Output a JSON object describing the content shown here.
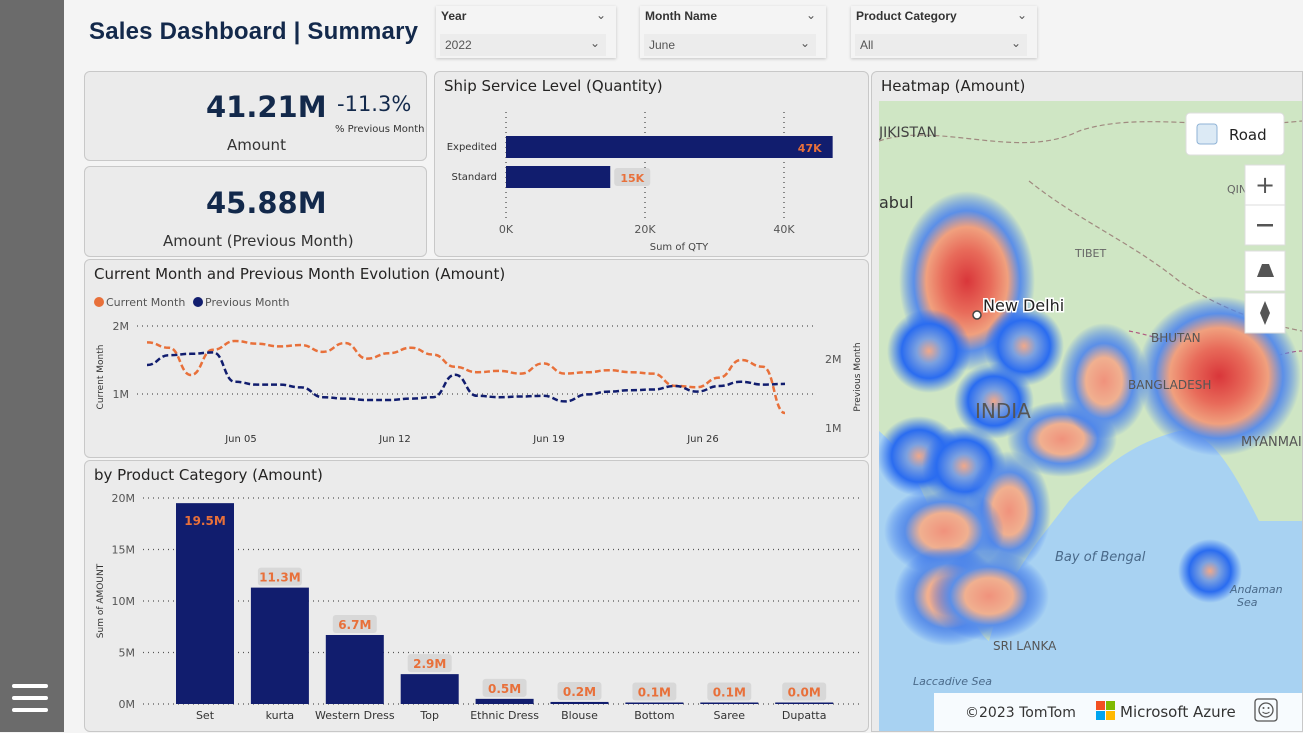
{
  "header": {
    "title": "Sales Dashboard | Summary"
  },
  "slicers": [
    {
      "label": "Year",
      "value": "2022"
    },
    {
      "label": "Month Name",
      "value": "June"
    },
    {
      "label": "Product Category",
      "value": "All"
    }
  ],
  "kpi_amount": {
    "value": "41.21M",
    "label": "Amount",
    "change": "-11.3%",
    "change_label": "% Previous Month"
  },
  "kpi_prev": {
    "value": "45.88M",
    "label": "Amount (Previous Month)"
  },
  "ship": {
    "title": "Ship Service Level (Quantity)",
    "xlabel": "Sum of QTY",
    "ticks": [
      "0K",
      "20K",
      "40K"
    ]
  },
  "evolution": {
    "title": "Current Month and Previous Month Evolution (Amount)",
    "legend_current": "Current Month",
    "legend_previous": "Previous Month",
    "left_axis_label": "Current Month",
    "right_axis_label": "Previous Month",
    "left_ticks": [
      "2M",
      "1M"
    ],
    "right_ticks": [
      "2M",
      "1M"
    ],
    "x_ticks": [
      "Jun 05",
      "Jun 12",
      "Jun 19",
      "Jun 26"
    ]
  },
  "category": {
    "title": "by Product Category (Amount)",
    "ylabel": "Sum of AMOUNT",
    "y_ticks": [
      "20M",
      "15M",
      "10M",
      "5M",
      "0M"
    ]
  },
  "map": {
    "title": "Heatmap (Amount)",
    "road_label": "Road",
    "copyright": "©2023 TomTom",
    "brand": "Microsoft Azure",
    "labels": {
      "tajikistan": "JIKISTAN",
      "kabul": "abul",
      "tibet": "TIBET",
      "new_delhi": "New Delhi",
      "bhutan": "BHUTAN",
      "bangladesh": "BANGLADESH",
      "india": "INDIA",
      "myanmar": "MYANMAI",
      "bay": "Bay of Bengal",
      "andaman": "Andaman",
      "andaman2": "Sea",
      "srilanka": "SRI LANKA",
      "laccadive": "Laccadive Sea",
      "qin": "QIN"
    }
  },
  "colors": {
    "navy": "#111d6e",
    "orange": "#e8703a",
    "title": "#13294b"
  },
  "chart_data": [
    {
      "type": "bar",
      "orientation": "horizontal",
      "title": "Ship Service Level (Quantity)",
      "categories": [
        "Expedited",
        "Standard"
      ],
      "values": [
        47000,
        15000
      ],
      "data_labels": [
        "47K",
        "15K"
      ],
      "xlabel": "Sum of QTY",
      "xlim": [
        0,
        50000
      ]
    },
    {
      "type": "line",
      "title": "Current Month and Previous Month Evolution (Amount)",
      "x": [
        "Jun 01",
        "Jun 02",
        "Jun 03",
        "Jun 04",
        "Jun 05",
        "Jun 06",
        "Jun 07",
        "Jun 08",
        "Jun 09",
        "Jun 10",
        "Jun 11",
        "Jun 12",
        "Jun 13",
        "Jun 14",
        "Jun 15",
        "Jun 16",
        "Jun 17",
        "Jun 18",
        "Jun 19",
        "Jun 20",
        "Jun 21",
        "Jun 22",
        "Jun 23",
        "Jun 24",
        "Jun 25",
        "Jun 26",
        "Jun 27",
        "Jun 28",
        "Jun 29",
        "Jun 30"
      ],
      "series": [
        {
          "name": "Current Month",
          "axis": "left",
          "values": [
            1.76,
            1.68,
            1.28,
            1.65,
            1.78,
            1.74,
            1.7,
            1.72,
            1.62,
            1.75,
            1.52,
            1.6,
            1.68,
            1.58,
            1.4,
            1.32,
            1.34,
            1.3,
            1.45,
            1.3,
            1.32,
            1.35,
            1.32,
            1.3,
            1.12,
            1.1,
            1.24,
            1.5,
            1.4,
            0.72
          ]
        },
        {
          "name": "Previous Month",
          "axis": "right",
          "values": [
            1.9,
            2.04,
            2.06,
            2.08,
            1.66,
            1.62,
            1.62,
            1.58,
            1.44,
            1.42,
            1.4,
            1.4,
            1.42,
            1.44,
            1.76,
            1.46,
            1.44,
            1.45,
            1.46,
            1.38,
            1.48,
            1.52,
            1.54,
            1.55,
            1.6,
            1.52,
            1.6,
            1.66,
            1.62,
            1.63
          ]
        }
      ],
      "left_ylim": [
        0.6,
        2.1
      ],
      "right_ylim": [
        0.8,
        2.3
      ]
    },
    {
      "type": "bar",
      "title": "by Product Category (Amount)",
      "categories": [
        "Set",
        "kurta",
        "Western Dress",
        "Top",
        "Ethnic Dress",
        "Blouse",
        "Bottom",
        "Saree",
        "Dupatta"
      ],
      "values": [
        19.5,
        11.3,
        6.7,
        2.9,
        0.5,
        0.2,
        0.1,
        0.1,
        0.0
      ],
      "data_labels": [
        "19.5M",
        "11.3M",
        "6.7M",
        "2.9M",
        "0.5M",
        "0.2M",
        "0.1M",
        "0.1M",
        "0.0M"
      ],
      "ylabel": "Sum of AMOUNT",
      "ylim": [
        0,
        20
      ]
    }
  ]
}
